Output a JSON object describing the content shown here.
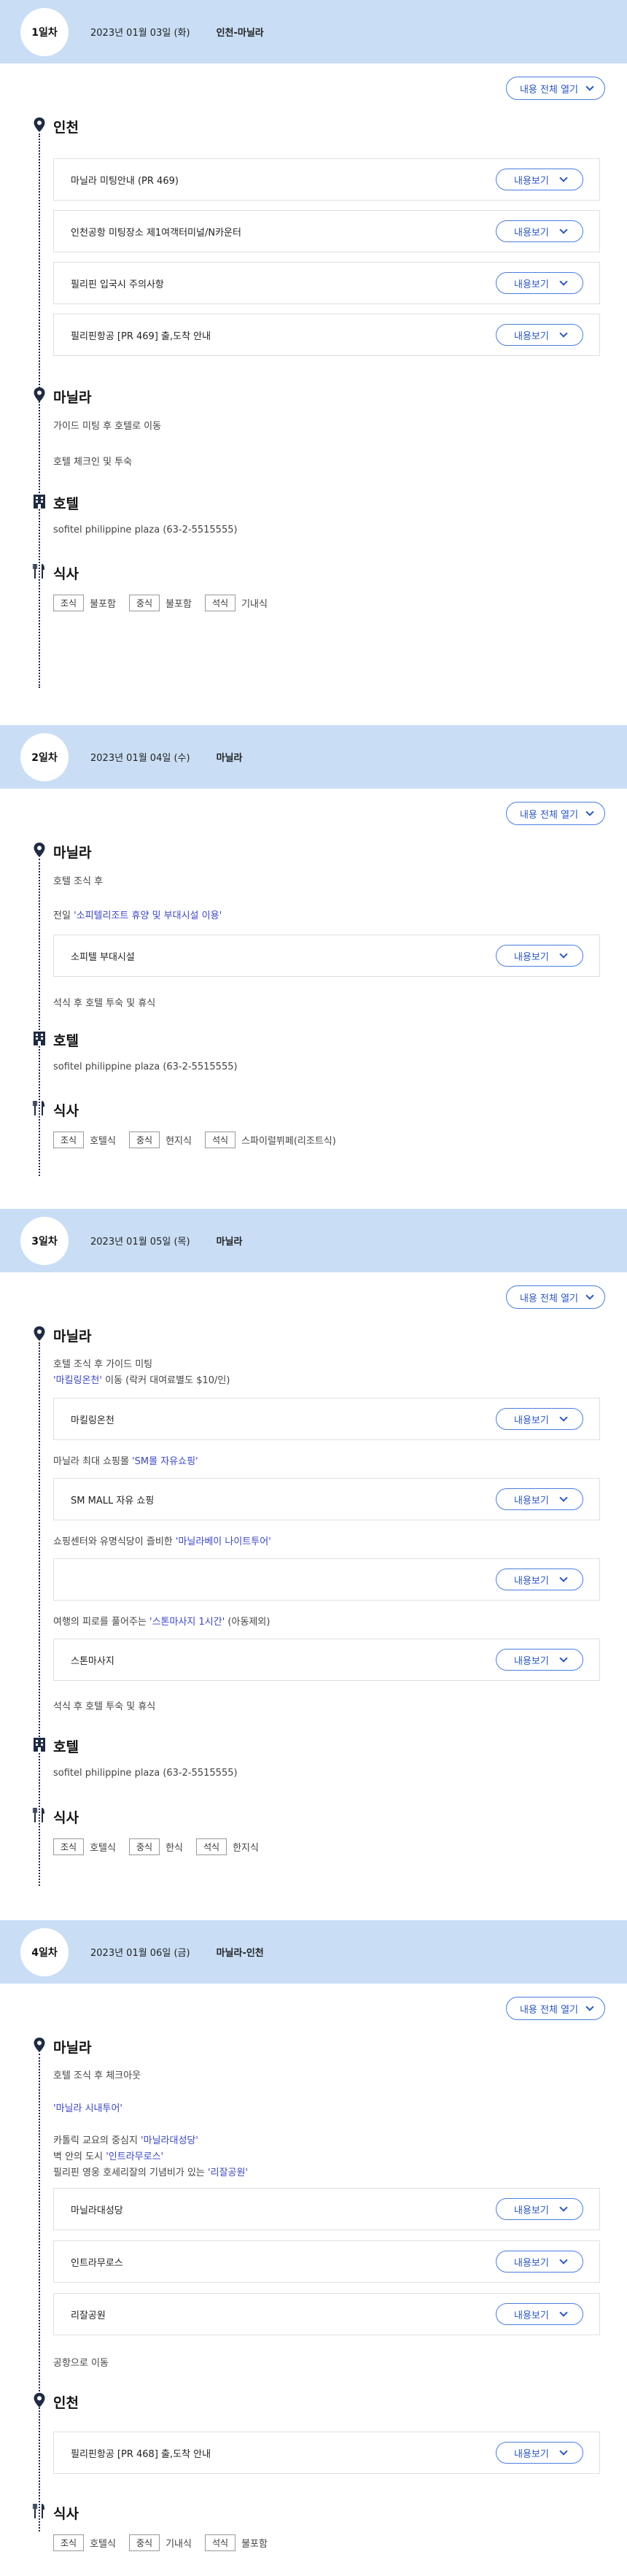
{
  "ui": {
    "expand_all": "내용 전체 열기",
    "view": "내용보기",
    "breakfast": "조식",
    "lunch": "중식",
    "dinner": "석식",
    "hotel_label": "호텔",
    "meal_label": "식사",
    "hotel_info": "sofitel philippine plaza (63-2-5515555)"
  },
  "days": [
    {
      "badge": "1일차",
      "date": "2023년 01월 03일 (화)",
      "route": "인천-마닐라",
      "city1": "인천",
      "c1": "마닐라 미팅안내 (PR 469)",
      "c2": "인천공항 미팅장소 제1여객터미널/N카운터",
      "c3": "필리핀 입국시 주의사항",
      "c4": "필리핀항공 [PR 469] 출,도착 안내",
      "city2": "마닐라",
      "t1": "가이드 미팅 후 호텔로 이동",
      "t2": "호텔 체크인 및 투숙",
      "meals": [
        "불포함",
        "불포함",
        "기내식"
      ]
    },
    {
      "badge": "2일차",
      "date": "2023년 01월 04일 (수)",
      "route": "마닐라",
      "city1": "마닐라",
      "t1": "호텔 조식 후",
      "t2a": "전일 ",
      "t2b": "'소피텔리조트 휴양 및 부대시설 이용'",
      "c1": "소피텔 부대시설",
      "t3": "석식 후 호텔 투숙 및 휴식",
      "meals": [
        "호텔식",
        "현지식",
        "스파이럴뷔페(리조트식)"
      ]
    },
    {
      "badge": "3일차",
      "date": "2023년 01월 05일 (목)",
      "route": "마닐라",
      "city1": "마닐라",
      "t1": "호텔 조식 후 가이드 미팅",
      "t2a": "'마킬링온천'",
      "t2b": " 이동 (락커 대여료별도 $10/인)",
      "c1": "마킬링온천",
      "t3a": "마닐라 최대 쇼핑몰 ",
      "t3b": "'SM몰 자유쇼핑'",
      "c2": "SM MALL 자유 쇼핑",
      "t4a": "쇼핑센터와 유명식당이 즐비한 ",
      "t4b": "'마닐라베이 나이트투어'",
      "c3": "",
      "t5a": "여행의 피로를 풀어주는 ",
      "t5b": "'스톤마사지 1시간'",
      "t5c": " (아동제외)",
      "c4": "스톤마사지",
      "t6": "석식 후 호텔 투숙 및 휴식",
      "meals": [
        "호텔식",
        "한식",
        "한지식"
      ]
    },
    {
      "badge": "4일차",
      "date": "2023년 01월 06일 (금)",
      "route": "마닐라-인천",
      "city1": "마닐라",
      "t1": "호텔 조식 후 체크아웃",
      "t2": "'마닐라 시내투어'",
      "t3a": "카톨릭 교요의 중심지 ",
      "t3b": "'마닐라대성당'",
      "t4a": "벽 안의 도시 ",
      "t4b": "'인트라무로스'",
      "t5a": "필리핀 영웅 호세리잘의 기념비가 있는 ",
      "t5b": "'리잘공원'",
      "c1": "마닐라대성당",
      "c2": "인트라무로스",
      "c3": "리잘공원",
      "t6": "공항으로 이동",
      "city2": "인천",
      "c4": "필리핀항공 [PR 468] 출,도착 안내",
      "meals": [
        "호텔식",
        "기내식",
        "불포함"
      ]
    }
  ]
}
